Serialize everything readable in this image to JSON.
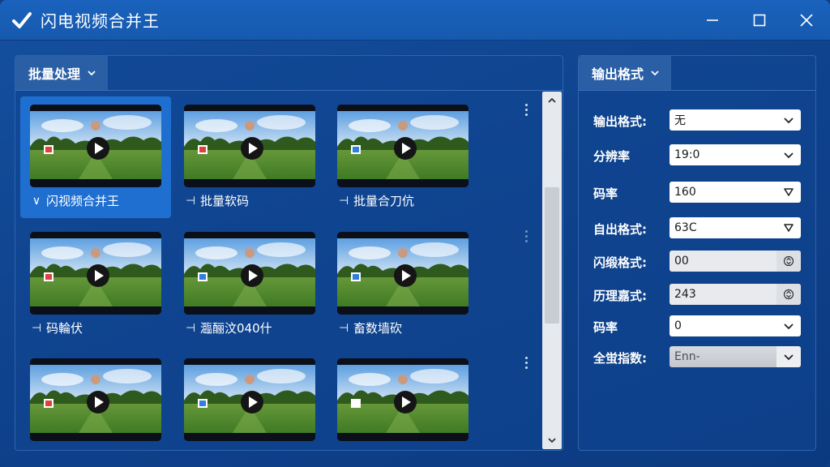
{
  "window": {
    "title": "闪电视频合并王",
    "icon": "check-icon"
  },
  "left_panel": {
    "tab_label": "批量处理"
  },
  "videos": [
    {
      "label": "闪视频合并王",
      "mark": "∨",
      "badge_color": "#e0413a",
      "selected": true
    },
    {
      "label": "批量软码",
      "mark": "⊣",
      "badge_color": "#e0413a",
      "selected": false
    },
    {
      "label": "批量合刀伉",
      "mark": "⊣",
      "badge_color": "#2f7fe0",
      "selected": false
    },
    {
      "label": "码輪伏",
      "mark": "⊣",
      "badge_color": "#e0413a",
      "selected": false
    },
    {
      "label": "瀶酾汶040什",
      "mark": "⊣",
      "badge_color": "#2f7fe0",
      "selected": false
    },
    {
      "label": "畜数墙砍",
      "mark": "⊣",
      "badge_color": "#2f7fe0",
      "selected": false
    },
    {
      "label": "",
      "mark": "",
      "badge_color": "#e0413a",
      "selected": false
    },
    {
      "label": "",
      "mark": "",
      "badge_color": "#2f7fe0",
      "selected": false
    },
    {
      "label": "",
      "mark": "",
      "badge_color": "#ffffff",
      "selected": false
    }
  ],
  "right_panel": {
    "tab_label": "输出格式",
    "fields": [
      {
        "label": "输出格式:",
        "value": "无",
        "control": "dropdown"
      },
      {
        "label": "分辨率",
        "value": "19:0",
        "control": "dropdown"
      },
      {
        "label": "码率",
        "value": "160",
        "control": "dropdown-triangle"
      },
      {
        "label": "自出格式:",
        "value": "63C",
        "control": "dropdown-triangle"
      },
      {
        "label": "闪缎格式:",
        "value": "00",
        "control": "spinner"
      },
      {
        "label": "历理嘉式:",
        "value": "243",
        "control": "spinner"
      },
      {
        "label": "码率",
        "value": "0",
        "control": "dropdown"
      },
      {
        "label": "全蛍指数:",
        "value": "Enn-",
        "control": "dropdown-dark"
      }
    ]
  }
}
